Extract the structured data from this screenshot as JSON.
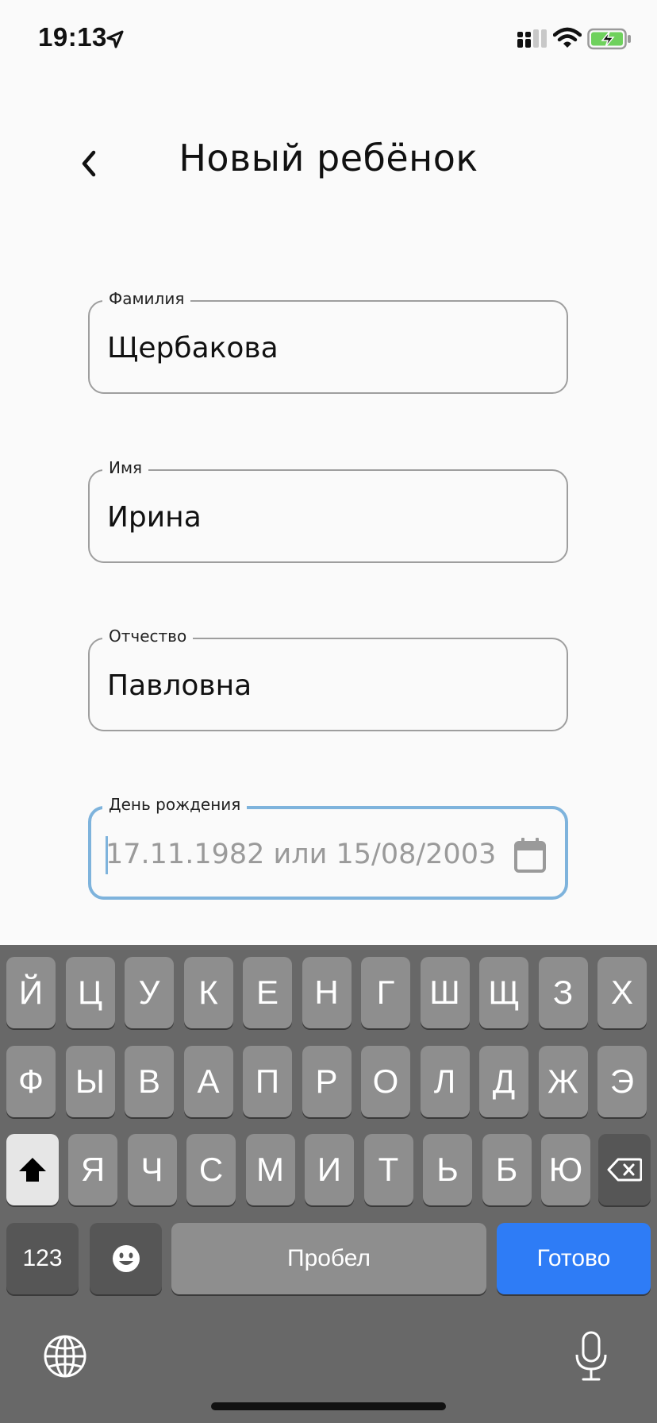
{
  "status_bar": {
    "time": "19:13",
    "icons": [
      "location-arrow-icon",
      "cellular-signal-icon",
      "wifi-icon",
      "battery-charging-icon"
    ],
    "battery_color": "#6fd15d"
  },
  "header": {
    "back_icon": "chevron-left-icon",
    "title": "Новый ребёнок"
  },
  "form": {
    "surname": {
      "label": "Фамилия",
      "value": "Щербакова"
    },
    "name": {
      "label": "Имя",
      "value": "Ирина"
    },
    "patronymic": {
      "label": "Отчество",
      "value": "Павловна"
    },
    "birthday": {
      "label": "День рождения",
      "value": "",
      "placeholder": "17.11.1982 или 15/08/2003",
      "icon": "calendar-icon",
      "focused": true,
      "focus_color": "#7eb3dc"
    }
  },
  "keyboard": {
    "row1": [
      "Й",
      "Ц",
      "У",
      "К",
      "Е",
      "Н",
      "Г",
      "Ш",
      "Щ",
      "З",
      "Х"
    ],
    "row2": [
      "Ф",
      "Ы",
      "В",
      "А",
      "П",
      "Р",
      "О",
      "Л",
      "Д",
      "Ж",
      "Э"
    ],
    "row3": [
      "Я",
      "Ч",
      "С",
      "М",
      "И",
      "Т",
      "Ь",
      "Б",
      "Ю"
    ],
    "numbers_label": "123",
    "space_label": "Пробел",
    "done_label": "Готово",
    "done_color": "#2e7cf6",
    "icons": [
      "shift-icon",
      "backspace-icon",
      "emoji-icon",
      "globe-icon",
      "microphone-icon"
    ]
  }
}
